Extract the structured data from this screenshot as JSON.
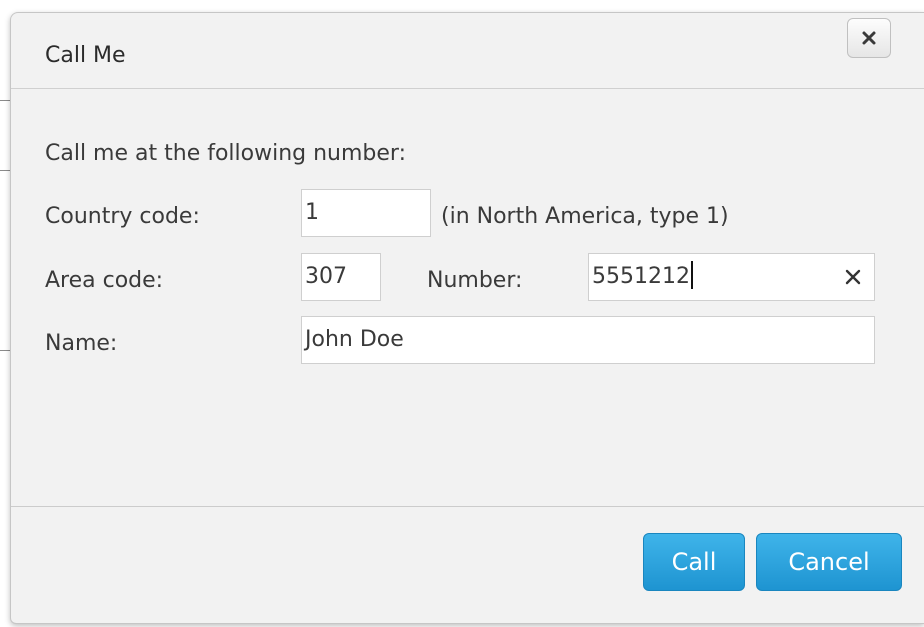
{
  "dialog": {
    "title": "Call Me",
    "close_icon": "close-icon"
  },
  "form": {
    "intro": "Call me at the following number:",
    "country_code": {
      "label": "Country code:",
      "value": "1",
      "hint": "(in North America, type 1)"
    },
    "area_code": {
      "label": "Area code:",
      "value": "307"
    },
    "number": {
      "label": "Number:",
      "value": "5551212",
      "clear_icon": "clear-icon"
    },
    "name": {
      "label": "Name:",
      "value": "John Doe"
    }
  },
  "buttons": {
    "call": "Call",
    "cancel": "Cancel"
  },
  "colors": {
    "primary_button": "#1e94d1",
    "dialog_background": "#f2f2f2"
  }
}
